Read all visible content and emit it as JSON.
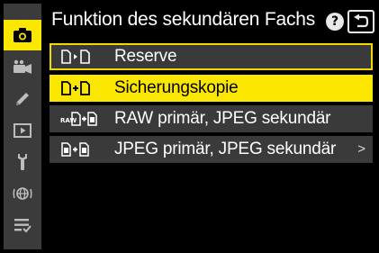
{
  "header": {
    "title": "Funktion des sekundären Fachs",
    "help_glyph": "?",
    "back_icon": "return-icon"
  },
  "rail": {
    "items": [
      {
        "icon": "camera-icon",
        "active": true
      },
      {
        "icon": "movie-camera-icon",
        "active": false
      },
      {
        "icon": "pencil-icon",
        "active": false
      },
      {
        "icon": "playback-icon",
        "active": false
      },
      {
        "icon": "wrench-icon",
        "active": false
      },
      {
        "icon": "network-icon",
        "active": false
      },
      {
        "icon": "my-menu-icon",
        "active": false
      }
    ]
  },
  "menu": {
    "items": [
      {
        "label": "Reserve",
        "icon": "overflow-slots-icon",
        "state": "outlined"
      },
      {
        "label": "Sicherungskopie",
        "icon": "backup-slots-icon",
        "state": "highlighted"
      },
      {
        "label": "RAW primär, JPEG sekundär",
        "icon": "raw-jpeg-slots-icon",
        "state": "normal"
      },
      {
        "label": "JPEG primär, JPEG sekundär",
        "icon": "jpeg-jpeg-slots-icon",
        "state": "normal",
        "has_submenu": true,
        "chevron": ">"
      }
    ]
  },
  "colors": {
    "accent_yellow": "#fbe600",
    "rail_bg": "#3b3b3b",
    "row_bg": "#3a3a3a",
    "text": "#ffffff"
  }
}
